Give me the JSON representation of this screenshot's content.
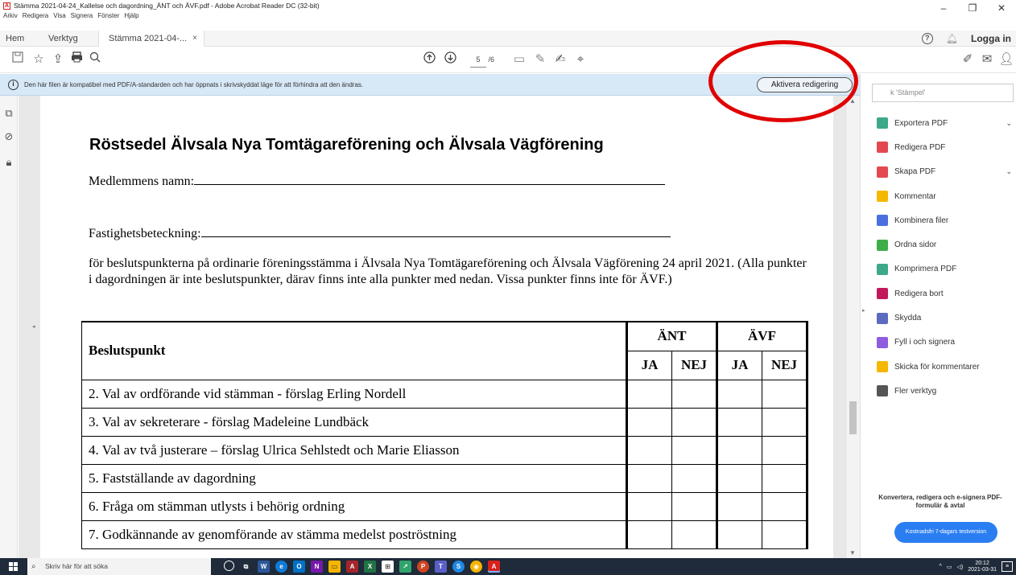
{
  "window": {
    "title": "Stämma 2021-04-24_Kallelse och dagordning_ÄNT och ÄVF.pdf - Adobe Acrobat Reader DC (32-bit)",
    "controls": [
      "–",
      "❐",
      "✕"
    ]
  },
  "menu": [
    "Arkiv",
    "Redigera",
    "Visa",
    "Signera",
    "Fönster",
    "Hjälp"
  ],
  "tabs": {
    "home": "Hem",
    "tools": "Verktyg",
    "doc": "Stämma 2021-04-...",
    "close": "×",
    "login": "Logga in"
  },
  "toolbar": {
    "page_current": "5",
    "page_total": "/6"
  },
  "infobar": {
    "message": "Den här filen är kompatibel med PDF/A-standarden och har öppnats i skrivskyddat läge för att förhindra att den ändras.",
    "enable_button": "Aktivera redigering"
  },
  "document": {
    "title": "Röstsedel Älvsala Nya Tomtägareförening och Älvsala Vägförening",
    "member_label": "Medlemmens namn:",
    "property_label": "Fastighetsbeteckning:",
    "intro": "för beslutspunkterna på ordinarie föreningsstämma i Älvsala Nya Tomtägareförening och Älvsala Vägförening 24 april 2021. (Alla punkter i dagordningen är inte beslutspunkter, därav finns inte alla punkter med nedan. Vissa punkter finns inte för ÄVF.)",
    "table": {
      "header_point": "Beslutspunkt",
      "group_ant": "ÄNT",
      "group_avf": "ÄVF",
      "ja": "JA",
      "nej": "NEJ",
      "rows": [
        "2. Val av ordförande vid stämman - förslag Erling Nordell",
        "3. Val av sekreterare - förslag Madeleine Lundbäck",
        "4. Val av två justerare – förslag Ulrica Sehlstedt och Marie Eliasson",
        "5. Fastställande av dagordning",
        "6. Fråga om stämman utlysts i behörig ordning",
        "7. Godkännande av genomförande av stämma medelst poströstning"
      ]
    }
  },
  "right_pane": {
    "search_placeholder": "k 'Stämpel'",
    "tools": [
      {
        "label": "Exportera PDF",
        "icon": "export-pdf-icon",
        "color": "#3da88a",
        "chevron": "⌄"
      },
      {
        "label": "Redigera PDF",
        "icon": "edit-pdf-icon",
        "color": "#e34850",
        "chevron": ""
      },
      {
        "label": "Skapa PDF",
        "icon": "create-pdf-icon",
        "color": "#e34850",
        "chevron": "⌄"
      },
      {
        "label": "Kommentar",
        "icon": "comment-icon",
        "color": "#f5b800",
        "chevron": ""
      },
      {
        "label": "Kombinera filer",
        "icon": "combine-files-icon",
        "color": "#4a6fe0",
        "chevron": ""
      },
      {
        "label": "Ordna sidor",
        "icon": "organize-pages-icon",
        "color": "#3fae49",
        "chevron": ""
      },
      {
        "label": "Komprimera PDF",
        "icon": "compress-pdf-icon",
        "color": "#3da88a",
        "chevron": ""
      },
      {
        "label": "Redigera bort",
        "icon": "redact-icon",
        "color": "#c2185b",
        "chevron": ""
      },
      {
        "label": "Skydda",
        "icon": "shield-icon",
        "color": "#5c6bc0",
        "chevron": ""
      },
      {
        "label": "Fyll i och signera",
        "icon": "fill-sign-icon",
        "color": "#8e5ce0",
        "chevron": ""
      },
      {
        "label": "Skicka för kommentarer",
        "icon": "send-comments-icon",
        "color": "#f5b800",
        "chevron": ""
      },
      {
        "label": "Fler verktyg",
        "icon": "more-tools-icon",
        "color": "#555555",
        "chevron": ""
      }
    ],
    "promo_text": "Konvertera, redigera och e-signera PDF-formulär & avtal",
    "promo_button": "Kostnadsfri 7-dagars testversion"
  },
  "taskbar": {
    "search_placeholder": "Skriv här för att söka",
    "time": "20:12",
    "date": "2021-03-31"
  }
}
